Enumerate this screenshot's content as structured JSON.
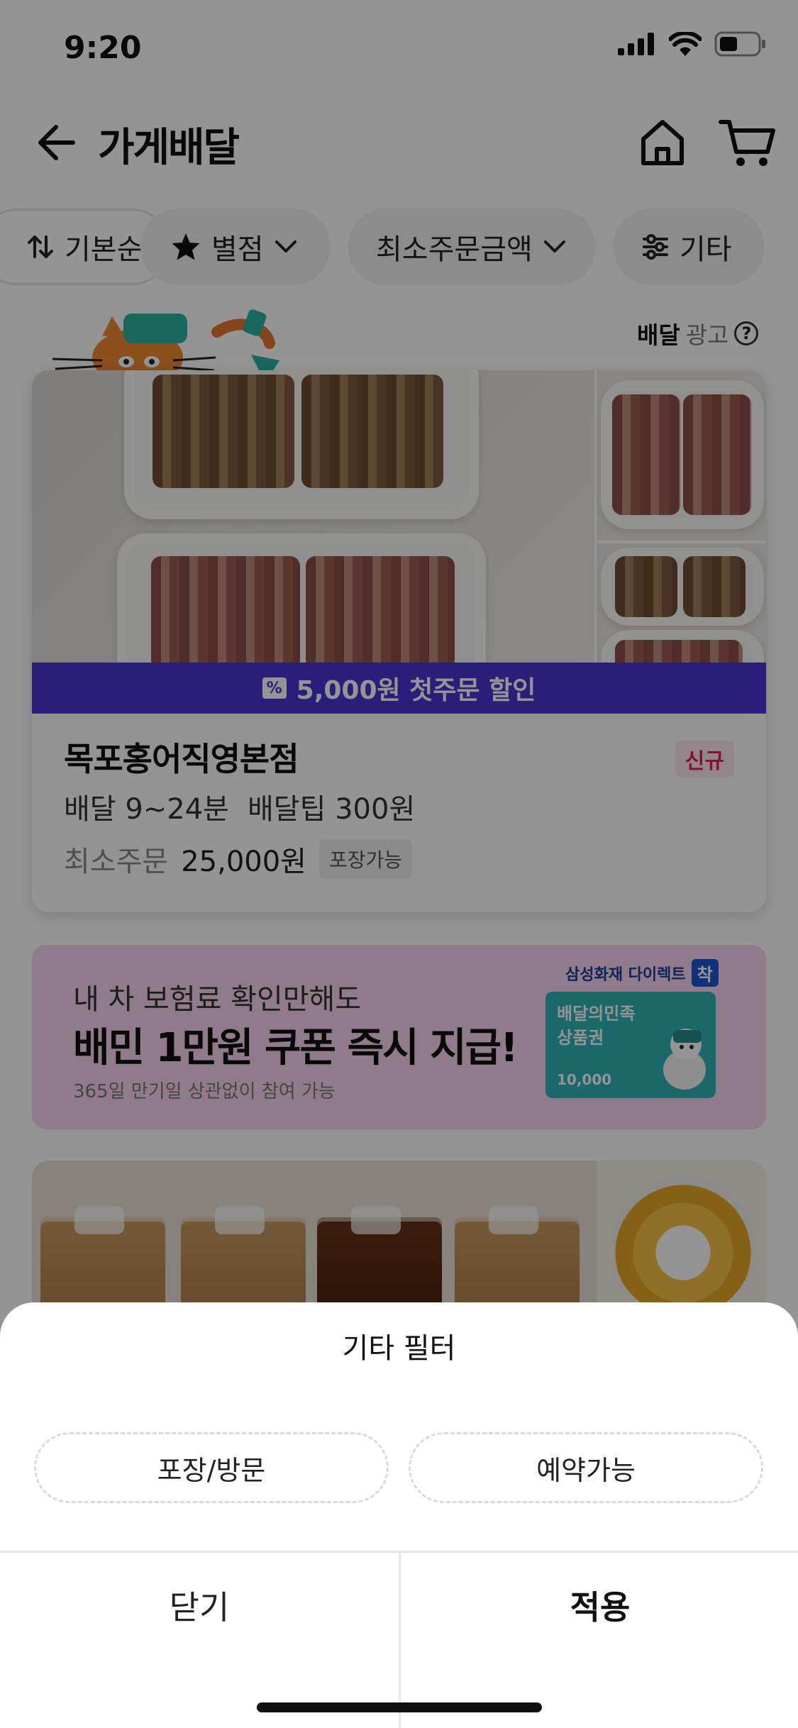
{
  "status_bar": {
    "time": "9:20"
  },
  "header": {
    "title": "가게배달"
  },
  "filters": {
    "sort_label": "기본순",
    "rating_label": "별점",
    "min_order_label": "최소주문금액",
    "etc_label": "기타"
  },
  "ad_label": {
    "type": "배달",
    "ad": "광고",
    "help": "?"
  },
  "store1": {
    "discount_banner": "5,000원 첫주문 할인",
    "name": "목포홍어직영본점",
    "badge": "신규",
    "delivery_time": "배달 9~24분",
    "delivery_tip": "배달팁 300원",
    "min_order_label": "최소주문",
    "min_order_value": "25,000원",
    "pickup_badge": "포장가능"
  },
  "promo": {
    "line1": "내 차 보험료 확인만해도",
    "line2": "배민 1만원 쿠폰 즉시 지급!",
    "line3": "365일 만기일 상관없이 참여 가능",
    "brand": "삼성화재 다이렉트",
    "brand_mark": "착",
    "giftcard_title": "배달의민족\n상품권",
    "giftcard_amount": "10,000"
  },
  "sheet": {
    "title": "기타 필터",
    "option_pickup": "포장/방문",
    "option_reservation": "예약가능",
    "close_label": "닫기",
    "apply_label": "적용"
  },
  "colors": {
    "accent_purple": "#4b34d3",
    "new_badge_pink": "#e0245e"
  },
  "icons": [
    "back-arrow-icon",
    "home-icon",
    "cart-icon",
    "sort-icon",
    "star-icon",
    "chevron-down-icon",
    "sliders-icon",
    "question-icon",
    "coupon-icon",
    "signal-icon",
    "wifi-icon",
    "battery-icon"
  ]
}
